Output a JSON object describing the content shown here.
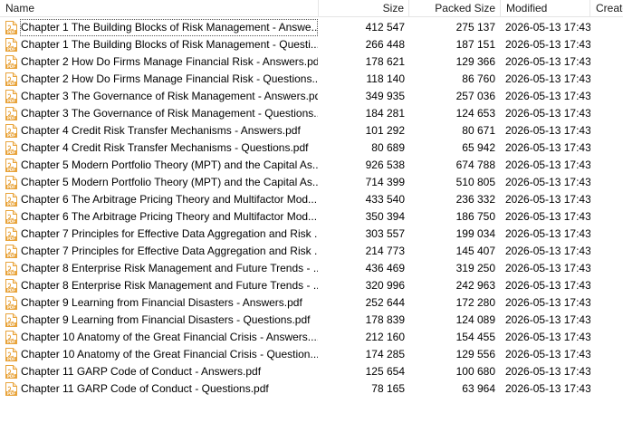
{
  "columns": {
    "name": "Name",
    "size": "Size",
    "packed_size": "Packed Size",
    "modified": "Modified",
    "created": "Create"
  },
  "icon": {
    "name": "pdf-file-icon",
    "color": "#e8a33a",
    "label": "PDF"
  },
  "files": [
    {
      "name": "Chapter 1 The Building Blocks of Risk Management - Answe...",
      "size": "412 547",
      "packed": "275 137",
      "modified": "2026-05-13 17:43"
    },
    {
      "name": "Chapter 1 The Building Blocks of Risk Management - Questi...",
      "size": "266 448",
      "packed": "187 151",
      "modified": "2026-05-13 17:43"
    },
    {
      "name": "Chapter 2 How Do Firms Manage Financial Risk - Answers.pdf",
      "size": "178 621",
      "packed": "129 366",
      "modified": "2026-05-13 17:43"
    },
    {
      "name": "Chapter 2 How Do Firms Manage Financial Risk - Questions....",
      "size": "118 140",
      "packed": "86 760",
      "modified": "2026-05-13 17:43"
    },
    {
      "name": "Chapter 3 The Governance of Risk Management - Answers.pdf",
      "size": "349 935",
      "packed": "257 036",
      "modified": "2026-05-13 17:43"
    },
    {
      "name": "Chapter 3 The Governance of Risk Management - Questions....",
      "size": "184 281",
      "packed": "124 653",
      "modified": "2026-05-13 17:43"
    },
    {
      "name": "Chapter 4 Credit Risk Transfer Mechanisms - Answers.pdf",
      "size": "101 292",
      "packed": "80 671",
      "modified": "2026-05-13 17:43"
    },
    {
      "name": "Chapter 4 Credit Risk Transfer Mechanisms - Questions.pdf",
      "size": "80 689",
      "packed": "65 942",
      "modified": "2026-05-13 17:43"
    },
    {
      "name": "Chapter 5 Modern Portfolio Theory (MPT) and the Capital As...",
      "size": "926 538",
      "packed": "674 788",
      "modified": "2026-05-13 17:43"
    },
    {
      "name": "Chapter 5 Modern Portfolio Theory (MPT) and the Capital As...",
      "size": "714 399",
      "packed": "510 805",
      "modified": "2026-05-13 17:43"
    },
    {
      "name": "Chapter 6 The Arbitrage Pricing Theory and Multifactor Mod...",
      "size": "433 540",
      "packed": "236 332",
      "modified": "2026-05-13 17:43"
    },
    {
      "name": "Chapter 6 The Arbitrage Pricing Theory and Multifactor Mod...",
      "size": "350 394",
      "packed": "186 750",
      "modified": "2026-05-13 17:43"
    },
    {
      "name": "Chapter 7 Principles for Effective Data Aggregation and Risk ...",
      "size": "303 557",
      "packed": "199 034",
      "modified": "2026-05-13 17:43"
    },
    {
      "name": "Chapter 7 Principles for Effective Data Aggregation and Risk ...",
      "size": "214 773",
      "packed": "145 407",
      "modified": "2026-05-13 17:43"
    },
    {
      "name": "Chapter 8 Enterprise Risk Management and Future Trends - ...",
      "size": "436 469",
      "packed": "319 250",
      "modified": "2026-05-13 17:43"
    },
    {
      "name": "Chapter 8 Enterprise Risk Management and Future Trends - ...",
      "size": "320 996",
      "packed": "242 963",
      "modified": "2026-05-13 17:43"
    },
    {
      "name": "Chapter 9 Learning from Financial Disasters - Answers.pdf",
      "size": "252 644",
      "packed": "172 280",
      "modified": "2026-05-13 17:43"
    },
    {
      "name": "Chapter 9 Learning from Financial Disasters - Questions.pdf",
      "size": "178 839",
      "packed": "124 089",
      "modified": "2026-05-13 17:43"
    },
    {
      "name": "Chapter 10 Anatomy of the Great Financial Crisis - Answers....",
      "size": "212 160",
      "packed": "154 455",
      "modified": "2026-05-13 17:43"
    },
    {
      "name": "Chapter 10 Anatomy of the Great Financial Crisis - Question...",
      "size": "174 285",
      "packed": "129 556",
      "modified": "2026-05-13 17:43"
    },
    {
      "name": "Chapter 11 GARP Code of Conduct - Answers.pdf",
      "size": "125 654",
      "packed": "100 680",
      "modified": "2026-05-13 17:43"
    },
    {
      "name": "Chapter 11 GARP Code of Conduct - Questions.pdf",
      "size": "78 165",
      "packed": "63 964",
      "modified": "2026-05-13 17:43"
    }
  ]
}
